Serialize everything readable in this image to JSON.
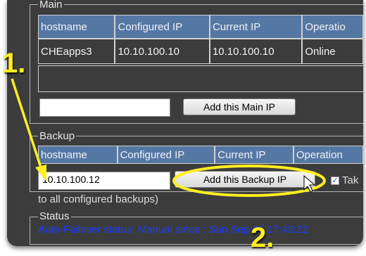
{
  "main": {
    "legend": "Main",
    "columns": [
      "hostname",
      "Configured IP",
      "Current IP",
      "Operatio"
    ],
    "row": [
      "CHEapps3",
      "10.10.100.10",
      "10.10.100.10",
      "Online"
    ],
    "input_value": "",
    "add_button": "Add this Main IP"
  },
  "backup": {
    "legend": "Backup",
    "columns": [
      "hostname",
      "Configured IP",
      "Current IP",
      "Operation"
    ],
    "input_value": "10.10.100.12",
    "add_button": "Add this Backup IP",
    "checkbox_label": "Tak",
    "checkbox_checked": true,
    "note": "to all configured backups)"
  },
  "status": {
    "legend": "Status",
    "text": "Auto-Failover status: Manual since : Sun Sep 26 17:43:22"
  },
  "callouts": {
    "step1": "1.",
    "step2": "2."
  },
  "colors": {
    "panel_bg": "#3c3c3c",
    "header_bg": "#5577a3",
    "status_text": "#1a3cff",
    "callout": "#ffee22"
  }
}
